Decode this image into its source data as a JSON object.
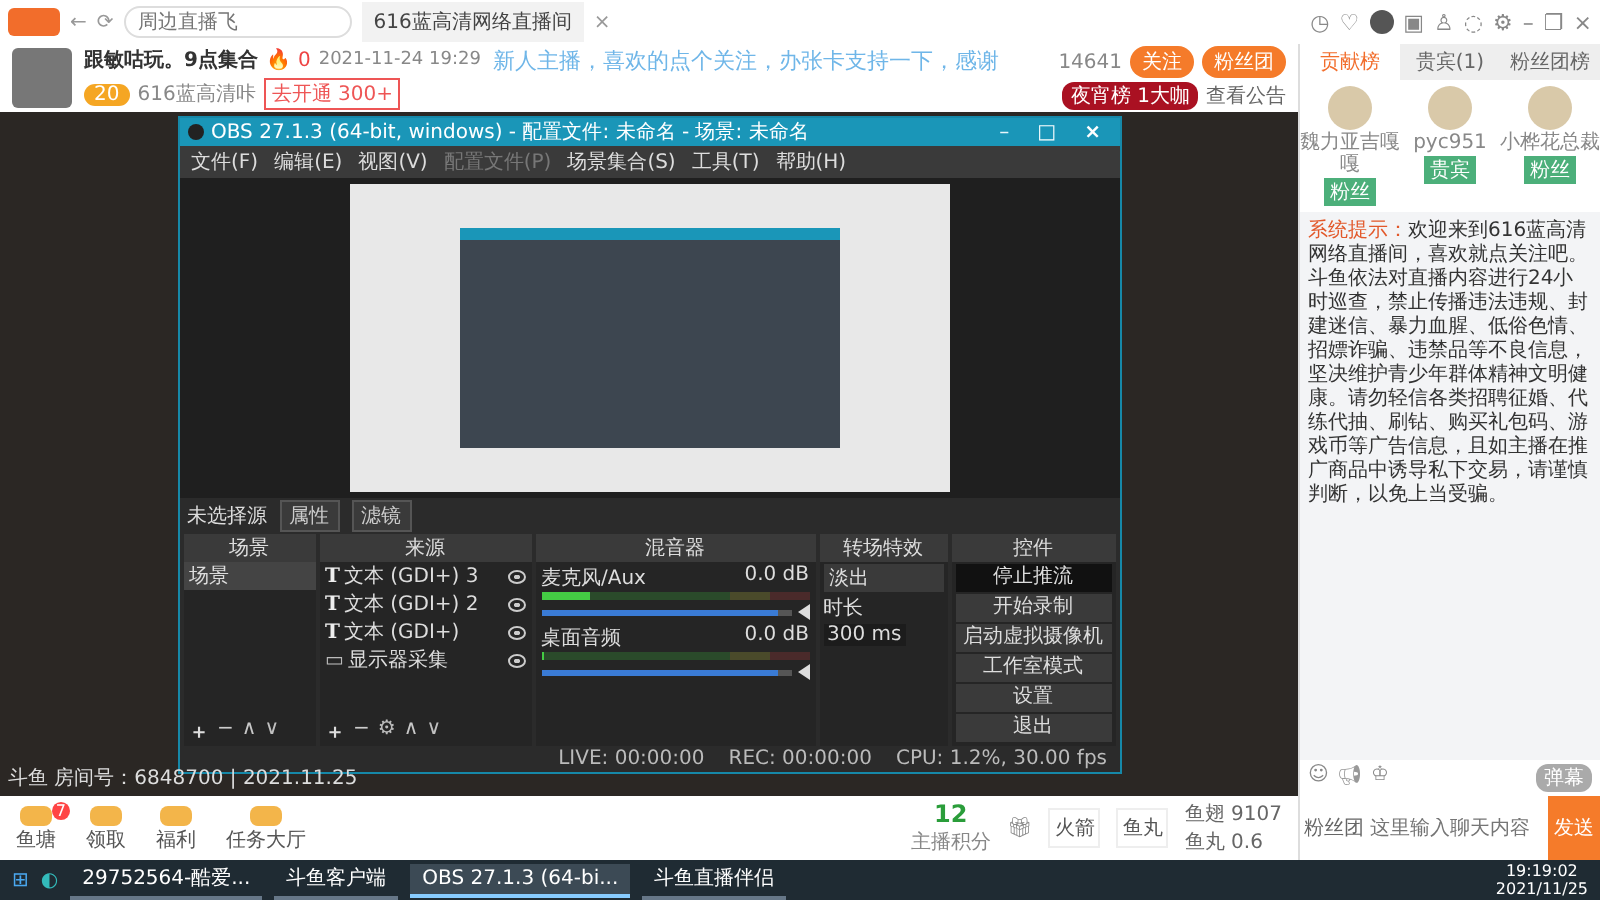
{
  "browser": {
    "back": "←",
    "refresh": "⟳",
    "search": {
      "placeholder": "周边直播飞"
    },
    "tab": {
      "title": "616蓝高清网络直播间",
      "close": "×"
    },
    "icons": [
      {
        "kind": "clock",
        "glyph": "◷"
      },
      {
        "kind": "heart",
        "glyph": "♡"
      },
      {
        "kind": "avatar"
      },
      {
        "kind": "calendar",
        "glyph": "▣"
      },
      {
        "kind": "shirt",
        "glyph": "♙"
      },
      {
        "kind": "chat",
        "glyph": "◌"
      },
      {
        "kind": "settings",
        "glyph": "⚙"
      },
      {
        "kind": "minimize",
        "glyph": "–"
      },
      {
        "kind": "restore",
        "glyph": "❐"
      },
      {
        "kind": "close",
        "glyph": "×"
      }
    ]
  },
  "room": {
    "title": "跟敏咕玩。9点集合",
    "hot_icon": "🔥",
    "hot": "0",
    "time": "2021-11-24 19:29",
    "level_badge": "20",
    "category": "616蓝高清咔",
    "promo": "去开通 300+",
    "followers": "14641",
    "follow_button": "关注",
    "fan_button": "粉丝团",
    "rank_badge": "夜宵榜 1大咖",
    "notice": "查看公告",
    "marquee": "新人主播，喜欢的点个关注，办张卡支持一下，感谢"
  },
  "obs": {
    "title": "OBS 27.1.3 (64-bit, windows) - 配置文件: 未命名 - 场景: 未命名",
    "window_controls": [
      {
        "kind": "minimize",
        "glyph": "–"
      },
      {
        "kind": "maximize",
        "glyph": "□"
      },
      {
        "kind": "close",
        "glyph": "×"
      }
    ],
    "menu": [
      {
        "label": "文件(F)",
        "disabled": false
      },
      {
        "label": "编辑(E)",
        "disabled": false
      },
      {
        "label": "视图(V)",
        "disabled": false
      },
      {
        "label": "配置文件(P)",
        "disabled": true
      },
      {
        "label": "场景集合(S)",
        "disabled": false
      },
      {
        "label": "工具(T)",
        "disabled": false
      },
      {
        "label": "帮助(H)",
        "disabled": false
      }
    ],
    "source_status": "未选择源",
    "source_buttons": [
      "属性",
      "滤镜"
    ],
    "docks": {
      "scenes": "场景",
      "sources": "来源",
      "mixer": "混音器",
      "transitions": "转场特效",
      "controls": "控件"
    },
    "scenes": [
      {
        "name": "场景",
        "selected": true
      }
    ],
    "scene_tools": [
      {
        "kind": "add",
        "glyph": "＋"
      },
      {
        "kind": "remove",
        "glyph": "−"
      },
      {
        "kind": "up",
        "glyph": "∧"
      },
      {
        "kind": "down",
        "glyph": "∨"
      }
    ],
    "sources": [
      {
        "kind": "text",
        "icon": "T",
        "name": "文本 (GDI+) 3"
      },
      {
        "kind": "text",
        "icon": "T",
        "name": "文本 (GDI+) 2"
      },
      {
        "kind": "text",
        "icon": "T",
        "name": "文本 (GDI+)"
      },
      {
        "kind": "display",
        "icon": "▭",
        "name": "显示器采集"
      }
    ],
    "source_tools": [
      {
        "kind": "add",
        "glyph": "＋"
      },
      {
        "kind": "remove",
        "glyph": "−"
      },
      {
        "kind": "settings",
        "glyph": "⚙"
      },
      {
        "kind": "up",
        "glyph": "∧"
      },
      {
        "kind": "down",
        "glyph": "∨"
      }
    ],
    "mixer": [
      {
        "name": "麦克风/Aux",
        "reading": "0.0 dB",
        "level": 0.18,
        "fader": {
          "level": 0.95
        }
      },
      {
        "name": "桌面音频",
        "reading": "0.0 dB",
        "level": 0,
        "fader": {
          "level": 0.95
        }
      }
    ],
    "transition": {
      "type": "淡出",
      "duration_label": "时长",
      "duration": "300 ms"
    },
    "controls": [
      {
        "label": "停止推流",
        "selected": true
      },
      {
        "label": "开始录制",
        "selected": false
      },
      {
        "label": "启动虚拟摄像机",
        "selected": false
      },
      {
        "label": "工作室模式",
        "selected": false
      },
      {
        "label": "设置",
        "selected": false
      },
      {
        "label": "退出",
        "selected": false
      }
    ],
    "status": {
      "live": "LIVE: 00:00:00",
      "rec": "REC: 00:00:00",
      "cpu": "CPU: 1.2%, 30.00 fps"
    }
  },
  "video_footer": "斗鱼 房间号：6848700 | 2021.11.25",
  "bottom_bar": {
    "apps": [
      {
        "label": "鱼塘",
        "badge": "7"
      },
      {
        "label": "领取"
      },
      {
        "label": "福利"
      },
      {
        "label": "任务大厅"
      }
    ],
    "points": "12",
    "points_label": "主播积分",
    "gift_icon": "🎁︎",
    "gifts": [
      "火箭",
      "鱼丸"
    ],
    "balances": [
      {
        "label": "鱼翅",
        "value": "9107"
      },
      {
        "label": "鱼丸",
        "value": "0.6"
      }
    ]
  },
  "side": {
    "tabs": [
      {
        "label": "贡献榜",
        "selected": true
      },
      {
        "label": "贵宾(1)",
        "selected": false
      },
      {
        "label": "粉丝团榜",
        "selected": false
      }
    ],
    "rankers": [
      {
        "name": "魏力亚吉嘎嘎",
        "tag": "粉丝"
      },
      {
        "name": "pyc951",
        "tag": "贵宾"
      },
      {
        "name": "小桦花总裁",
        "tag": "粉丝"
      }
    ],
    "system_label": "系统提示：",
    "system_message": "欢迎来到616蓝高清网络直播间，喜欢就点关注吧。斗鱼依法对直播内容进行24小时巡查，禁止传播违法违规、封建迷信、暴力血腥、低俗色情、招嫖诈骗、违禁品等不良信息，坚决维护青少年群体精神文明健康。请勿轻信各类招聘征婚、代练代抽、刷钻、购买礼包码、游戏币等广告信息，且如主播在推广商品中诱导私下交易，请谨慎判断，以免上当受骗。",
    "chat_tools": [
      {
        "kind": "emoji",
        "glyph": "☺"
      },
      {
        "kind": "megaphone",
        "glyph": "📢︎"
      },
      {
        "kind": "crown",
        "glyph": "♔"
      }
    ],
    "chat_mode": "弹幕",
    "chat_placeholder": "这里输入聊天内容",
    "send": "发送",
    "fan_label": "粉丝团"
  },
  "taskbar": {
    "start": "⊞",
    "browser": "◐",
    "apps": [
      {
        "label": "29752564-酷爱...",
        "selected": false
      },
      {
        "label": "斗鱼客户端",
        "selected": false
      },
      {
        "label": "OBS 27.1.3 (64-bi...",
        "selected": true
      },
      {
        "label": "斗鱼直播伴侣",
        "selected": false
      }
    ],
    "time": "19:19:02",
    "date": "2021/11/25"
  }
}
